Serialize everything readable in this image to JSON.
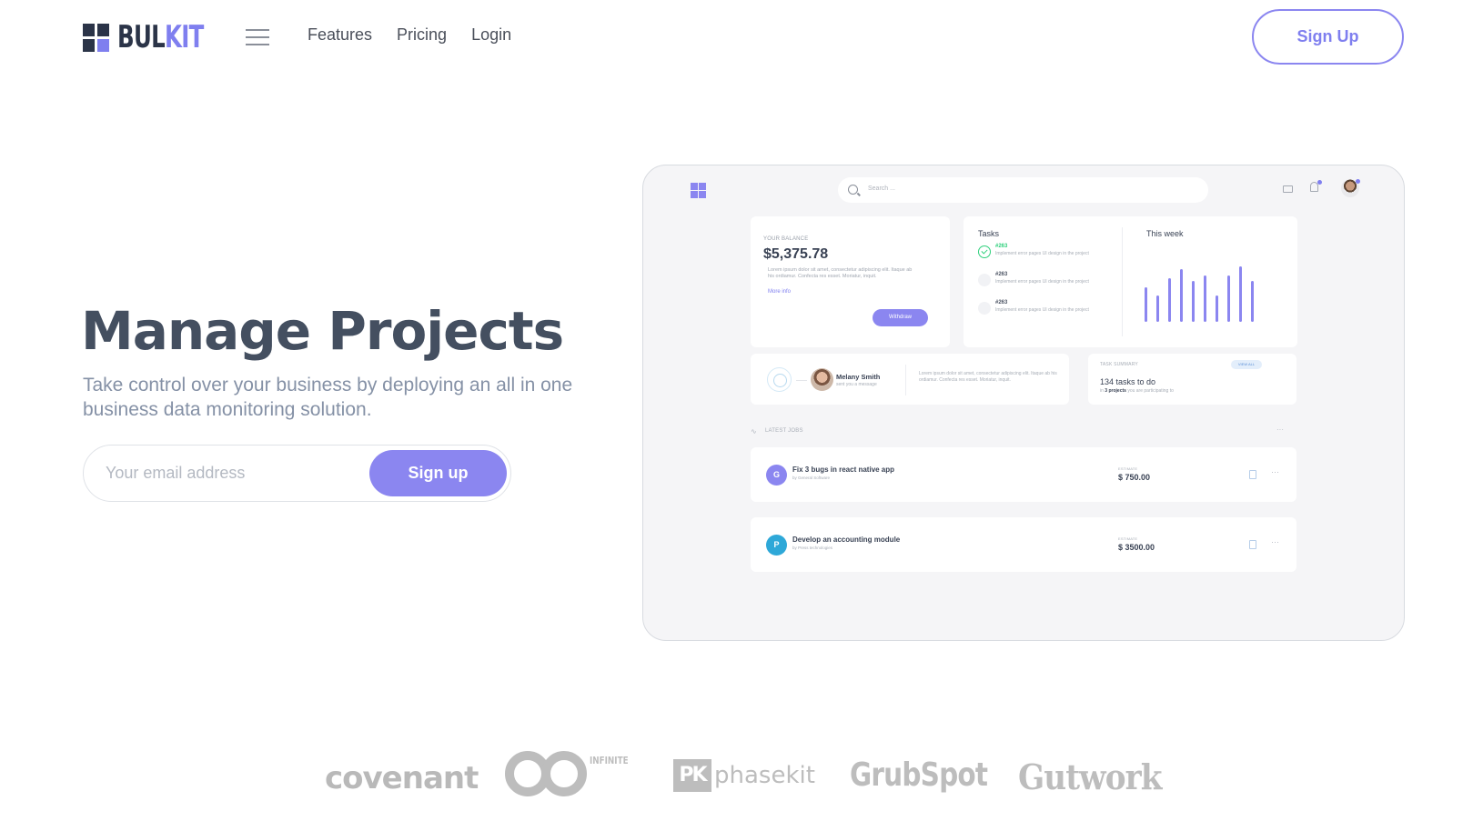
{
  "brand": {
    "name_part1": "BUL",
    "name_part2": "KIT",
    "accent": "#7f7fef",
    "dark": "#2b3448"
  },
  "nav": {
    "links": [
      "Features",
      "Pricing",
      "Login"
    ],
    "signup_label": "Sign Up",
    "menu_icon": "hamburger-icon"
  },
  "hero": {
    "title": "Manage Projects",
    "subtitle": "Take control over your business by deploying an all in one business data monitoring solution.",
    "email_placeholder": "Your email address",
    "cta_label": "Sign up"
  },
  "dashboard": {
    "search_placeholder": "Search ...",
    "balance": {
      "label": "YOUR BALANCE",
      "amount": "$5,375.78",
      "text": "Lorem ipsum dolor sit amet, consectetur adipiscing elit. Itaque ab his ordiamur. Confecta res esset. Moriatur, inquit.",
      "more_link": "More info",
      "withdraw_label": "Withdraw"
    },
    "tasks": {
      "title": "Tasks",
      "items": [
        {
          "id": "#263",
          "desc": "Implement error pages UI design in the project",
          "done": true
        },
        {
          "id": "#263",
          "desc": "Implement error pages UI design in the project",
          "done": false
        },
        {
          "id": "#263",
          "desc": "Implement error pages UI design in the project",
          "done": false
        }
      ]
    },
    "this_week": {
      "title": "This week",
      "bar_values": [
        0.6,
        0.45,
        0.75,
        0.9,
        0.7,
        0.8,
        0.45,
        0.8,
        0.95,
        0.7
      ]
    },
    "message": {
      "name": "Melany Smith",
      "sub": "sent you a message",
      "text": "Lorem ipsum dolor sit amet, consectetur adipiscing elit. Itaque ab his ordiamur. Confecta res esset. Moriatur, inquit."
    },
    "task_summary": {
      "label": "TASK SUMMARY",
      "badge": "VIEW ALL",
      "headline": "134 tasks to do",
      "sub_prefix": "in",
      "sub_bold": "3 projects",
      "sub_suffix": "you are participating to"
    },
    "latest_jobs": {
      "label": "LATEST JOBS",
      "jobs": [
        {
          "initial": "G",
          "title": "Fix 3 bugs in react native app",
          "by": "by General Software",
          "estimate_label": "ESTIMATE",
          "estimate": "$ 750.00",
          "color": "#8b86f0"
        },
        {
          "initial": "P",
          "title": "Develop an accounting module",
          "by": "by Press technologies",
          "estimate_label": "ESTIMATE",
          "estimate": "$ 3500.00",
          "color": "#2ea8d8"
        }
      ]
    }
  },
  "partners": {
    "covenant": "covenant",
    "infinite": "INFINITE",
    "phasekit_mark": "PK",
    "phasekit": "phasekit",
    "grubspot": "GrubSpot",
    "gutwork": "Gutwork"
  }
}
